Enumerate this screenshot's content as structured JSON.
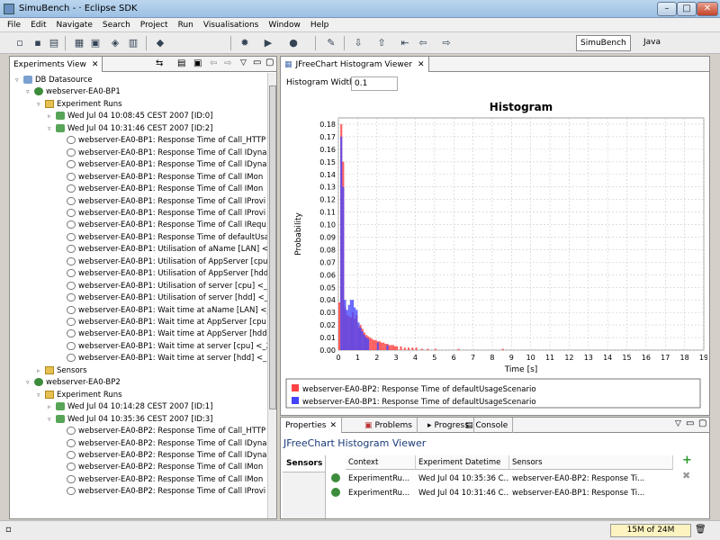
{
  "window": {
    "title": "SimuBench - · Eclipse SDK",
    "min": "–",
    "max": "□",
    "close": "✕"
  },
  "menu": [
    "File",
    "Edit",
    "Navigate",
    "Search",
    "Project",
    "Run",
    "Visualisations",
    "Window",
    "Help"
  ],
  "perspectives": {
    "active": "SimuBench",
    "other": "Java"
  },
  "experiments_view": {
    "tab_label": "Experiments View",
    "tree": [
      {
        "level": 0,
        "exp": "▿",
        "icon": "db",
        "text": "DB Datasource"
      },
      {
        "level": 1,
        "exp": "▿",
        "icon": "srv",
        "text": "webserver-EA0-BP1"
      },
      {
        "level": 2,
        "exp": "▿",
        "icon": "fold",
        "text": "Experiment Runs"
      },
      {
        "level": 3,
        "exp": "▹",
        "icon": "run",
        "text": "Wed Jul 04 10:08:45 CEST 2007 [ID:0]"
      },
      {
        "level": 3,
        "exp": "▿",
        "icon": "run",
        "text": "Wed Jul 04 10:31:46 CEST 2007 [ID:2]"
      },
      {
        "level": 4,
        "exp": "",
        "icon": "data",
        "text": "webserver-EA0-BP1: Response Time of Call_HTTP"
      },
      {
        "level": 4,
        "exp": "",
        "icon": "data",
        "text": "webserver-EA0-BP1: Response Time of Call IDyna"
      },
      {
        "level": 4,
        "exp": "",
        "icon": "data",
        "text": "webserver-EA0-BP1: Response Time of Call IDyna"
      },
      {
        "level": 4,
        "exp": "",
        "icon": "data",
        "text": "webserver-EA0-BP1: Response Time of Call IMon"
      },
      {
        "level": 4,
        "exp": "",
        "icon": "data",
        "text": "webserver-EA0-BP1: Response Time of Call IMon"
      },
      {
        "level": 4,
        "exp": "",
        "icon": "data",
        "text": "webserver-EA0-BP1: Response Time of Call IProvi"
      },
      {
        "level": 4,
        "exp": "",
        "icon": "data",
        "text": "webserver-EA0-BP1: Response Time of Call IProvi"
      },
      {
        "level": 4,
        "exp": "",
        "icon": "data",
        "text": "webserver-EA0-BP1: Response Time of Call IRequ"
      },
      {
        "level": 4,
        "exp": "",
        "icon": "data",
        "text": "webserver-EA0-BP1: Response Time of defaultUsa"
      },
      {
        "level": 4,
        "exp": "",
        "icon": "data",
        "text": "webserver-EA0-BP1: Utilisation of aName [LAN] <"
      },
      {
        "level": 4,
        "exp": "",
        "icon": "data",
        "text": "webserver-EA0-BP1: Utilisation of AppServer [cpu"
      },
      {
        "level": 4,
        "exp": "",
        "icon": "data",
        "text": "webserver-EA0-BP1: Utilisation of AppServer [hdd"
      },
      {
        "level": 4,
        "exp": "",
        "icon": "data",
        "text": "webserver-EA0-BP1: Utilisation of server [cpu] <_"
      },
      {
        "level": 4,
        "exp": "",
        "icon": "data",
        "text": "webserver-EA0-BP1: Utilisation of server [hdd] <_"
      },
      {
        "level": 4,
        "exp": "",
        "icon": "data",
        "text": "webserver-EA0-BP1: Wait time at aName [LAN] <_"
      },
      {
        "level": 4,
        "exp": "",
        "icon": "data",
        "text": "webserver-EA0-BP1: Wait time at AppServer [cpu"
      },
      {
        "level": 4,
        "exp": "",
        "icon": "data",
        "text": "webserver-EA0-BP1: Wait time at AppServer [hdd"
      },
      {
        "level": 4,
        "exp": "",
        "icon": "data",
        "text": "webserver-EA0-BP1: Wait time at server [cpu] <_2"
      },
      {
        "level": 4,
        "exp": "",
        "icon": "data",
        "text": "webserver-EA0-BP1: Wait time at server [hdd] <_2"
      },
      {
        "level": 2,
        "exp": "▹",
        "icon": "fold",
        "text": "Sensors"
      },
      {
        "level": 1,
        "exp": "▿",
        "icon": "srv",
        "text": "webserver-EA0-BP2"
      },
      {
        "level": 2,
        "exp": "▿",
        "icon": "fold",
        "text": "Experiment Runs"
      },
      {
        "level": 3,
        "exp": "▹",
        "icon": "run",
        "text": "Wed Jul 04 10:14:28 CEST 2007 [ID:1]"
      },
      {
        "level": 3,
        "exp": "▿",
        "icon": "run",
        "text": "Wed Jul 04 10:35:36 CEST 2007 [ID:3]"
      },
      {
        "level": 4,
        "exp": "",
        "icon": "data",
        "text": "webserver-EA0-BP2: Response Time of Call_HTTP"
      },
      {
        "level": 4,
        "exp": "",
        "icon": "data",
        "text": "webserver-EA0-BP2: Response Time of Call IDyna"
      },
      {
        "level": 4,
        "exp": "",
        "icon": "data",
        "text": "webserver-EA0-BP2: Response Time of Call IDyna"
      },
      {
        "level": 4,
        "exp": "",
        "icon": "data",
        "text": "webserver-EA0-BP2: Response Time of Call IMon"
      },
      {
        "level": 4,
        "exp": "",
        "icon": "data",
        "text": "webserver-EA0-BP2: Response Time of Call IMon"
      },
      {
        "level": 4,
        "exp": "",
        "icon": "data",
        "text": "webserver-EA0-BP2: Response Time of Call IProvi"
      }
    ]
  },
  "histogram_view": {
    "tab_label": "JFreeChart Histogram Viewer",
    "width_label": "Histogram Width",
    "width_value": "0.1"
  },
  "chart_data": {
    "type": "bar",
    "title": "Histogram",
    "xlabel": "Time [s]",
    "ylabel": "Probability",
    "xlim": [
      0,
      19
    ],
    "ylim": [
      0,
      0.185
    ],
    "bin_width": 0.1,
    "x_ticks": [
      0,
      1,
      2,
      3,
      4,
      5,
      6,
      7,
      8,
      9,
      10,
      11,
      12,
      13,
      14,
      15,
      16,
      17,
      18,
      19
    ],
    "y_ticks": [
      "0.00",
      "0.01",
      "0.02",
      "0.03",
      "0.04",
      "0.05",
      "0.06",
      "0.07",
      "0.08",
      "0.09",
      "0.10",
      "0.11",
      "0.12",
      "0.13",
      "0.14",
      "0.15",
      "0.16",
      "0.17",
      "0.18"
    ],
    "grid": true,
    "legend": "bottom",
    "series": [
      {
        "name": "webserver-EA0-BP2: Response Time of defaultUsageScenario",
        "color": "#ff4444",
        "x": [
          0.0,
          0.1,
          0.2,
          0.3,
          0.4,
          0.5,
          0.6,
          0.7,
          0.8,
          0.9,
          1.0,
          1.1,
          1.2,
          1.3,
          1.4,
          1.5,
          1.6,
          1.7,
          1.8,
          1.9,
          2.0,
          2.1,
          2.2,
          2.3,
          2.4,
          2.5,
          2.6,
          2.7,
          2.8,
          2.9,
          3.0,
          3.2,
          3.4,
          3.6,
          3.8,
          4.0,
          4.3,
          4.6,
          5.0,
          6.2,
          8.5
        ],
        "values": [
          0.038,
          0.18,
          0.15,
          0.034,
          0.028,
          0.027,
          0.026,
          0.03,
          0.025,
          0.028,
          0.018,
          0.02,
          0.017,
          0.014,
          0.012,
          0.011,
          0.01,
          0.009,
          0.008,
          0.008,
          0.007,
          0.007,
          0.006,
          0.006,
          0.005,
          0.005,
          0.004,
          0.004,
          0.004,
          0.003,
          0.003,
          0.003,
          0.002,
          0.002,
          0.002,
          0.002,
          0.001,
          0.001,
          0.001,
          0.001,
          0.001
        ]
      },
      {
        "name": "webserver-EA0-BP1: Response Time of defaultUsageScenario",
        "color": "#4444ff",
        "x": [
          0.1,
          0.2,
          0.3,
          0.4,
          0.5,
          0.6,
          0.7,
          0.8,
          0.9,
          1.0,
          1.1,
          1.2,
          1.3,
          1.4,
          1.5,
          2.0,
          2.5
        ],
        "values": [
          0.17,
          0.13,
          0.04,
          0.032,
          0.036,
          0.04,
          0.04,
          0.034,
          0.032,
          0.022,
          0.018,
          0.015,
          0.012,
          0.01,
          0.009,
          0.006,
          0.004
        ]
      }
    ]
  },
  "bottom_tabs": [
    "Properties",
    "Problems",
    "Progress",
    "Console"
  ],
  "properties": {
    "header": "JFreeChart Histogram Viewer",
    "section": "Sensors",
    "columns": [
      "Context",
      "Experiment Datetime",
      "Sensors"
    ],
    "rows": [
      [
        "ExperimentRu...",
        "Wed Jul 04 10:35:36 C...",
        "webserver-EA0-BP2: Response Ti..."
      ],
      [
        "ExperimentRu...",
        "Wed Jul 04 10:31:46 C...",
        "webserver-EA0-BP1: Response Ti..."
      ]
    ],
    "add": "+",
    "remove": "✖"
  },
  "status": {
    "heap": "15M of 24M"
  },
  "colors": {
    "bp2": "#ff4444",
    "bp1": "#4444ff"
  }
}
